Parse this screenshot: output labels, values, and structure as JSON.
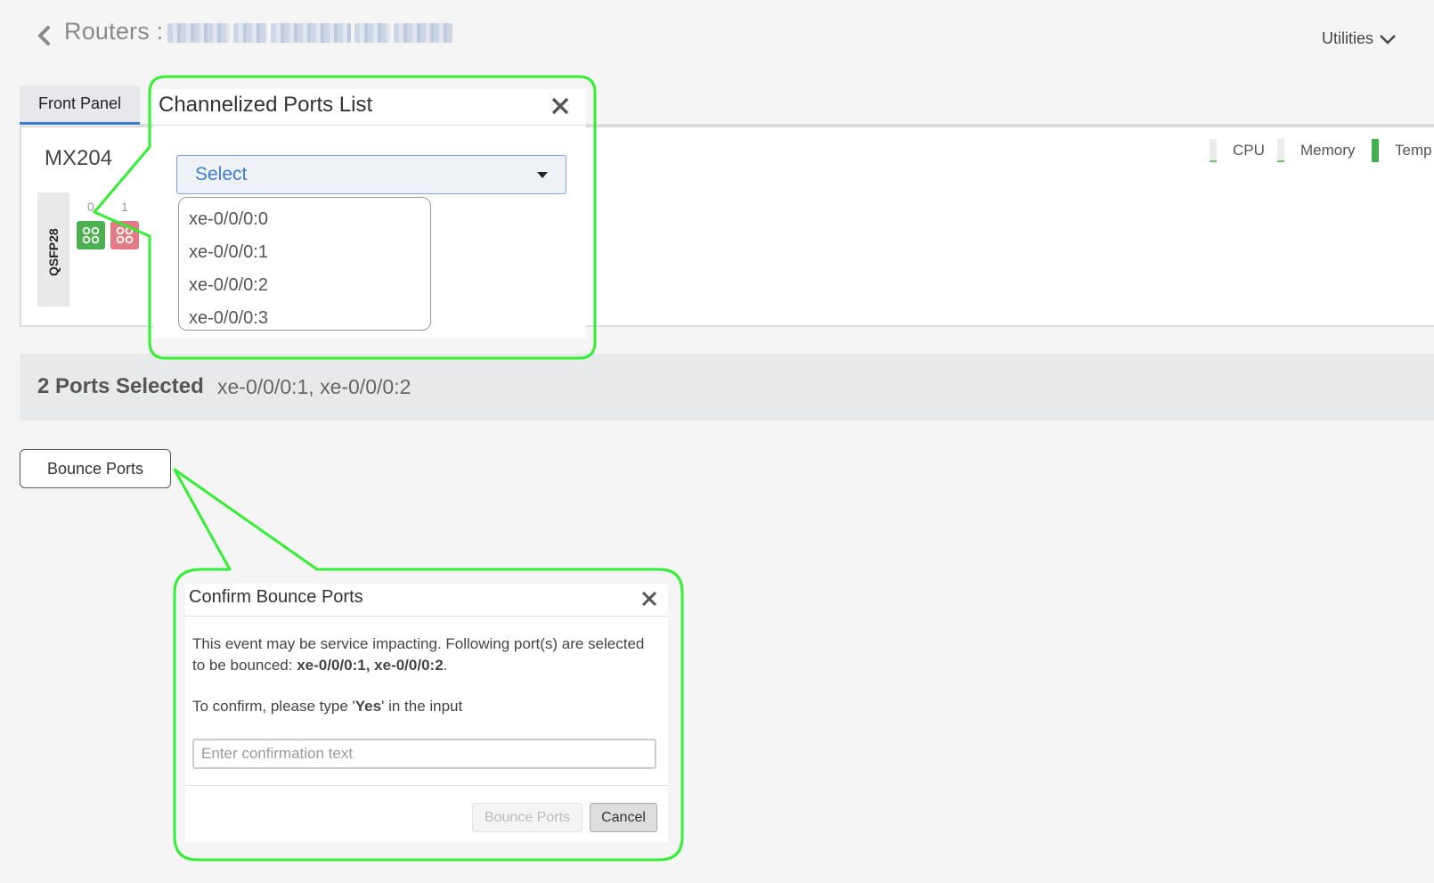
{
  "header": {
    "breadcrumb_label": "Routers :",
    "utilities_label": "Utilities"
  },
  "tabs": [
    {
      "label": "Front Panel",
      "active": true
    }
  ],
  "router": {
    "model": "MX204",
    "port_group_label": "QSFP28",
    "ports": [
      {
        "index": "0",
        "status": "up"
      },
      {
        "index": "1",
        "status": "down"
      }
    ],
    "legend": [
      {
        "label": "CPU"
      },
      {
        "label": "Memory"
      },
      {
        "label": "Temp"
      }
    ]
  },
  "selection": {
    "count_label": "2 Ports Selected",
    "ports_list": "xe-0/0/0:1, xe-0/0/0:2"
  },
  "actions": {
    "bounce_label": "Bounce Ports"
  },
  "channelized_dialog": {
    "title": "Channelized Ports List",
    "select_label": "Select",
    "options": [
      "xe-0/0/0:0",
      "xe-0/0/0:1",
      "xe-0/0/0:2",
      "xe-0/0/0:3"
    ]
  },
  "confirm_dialog": {
    "title": "Confirm Bounce Ports",
    "message_prefix": "This event may be service impacting. Following port(s) are selected to be bounced: ",
    "message_ports": "xe-0/0/0:1, xe-0/0/0:2",
    "message_suffix": ".",
    "instruction_prefix": "To confirm, please type '",
    "instruction_keyword": "Yes",
    "instruction_suffix": "' in the input",
    "input_placeholder": "Enter confirmation text",
    "input_value": "",
    "confirm_label": "Bounce Ports",
    "cancel_label": "Cancel"
  },
  "colors": {
    "accent": "#3a7bd5",
    "port_up": "#4cb050",
    "port_down": "#e27b86",
    "callout": "#33ee33"
  }
}
